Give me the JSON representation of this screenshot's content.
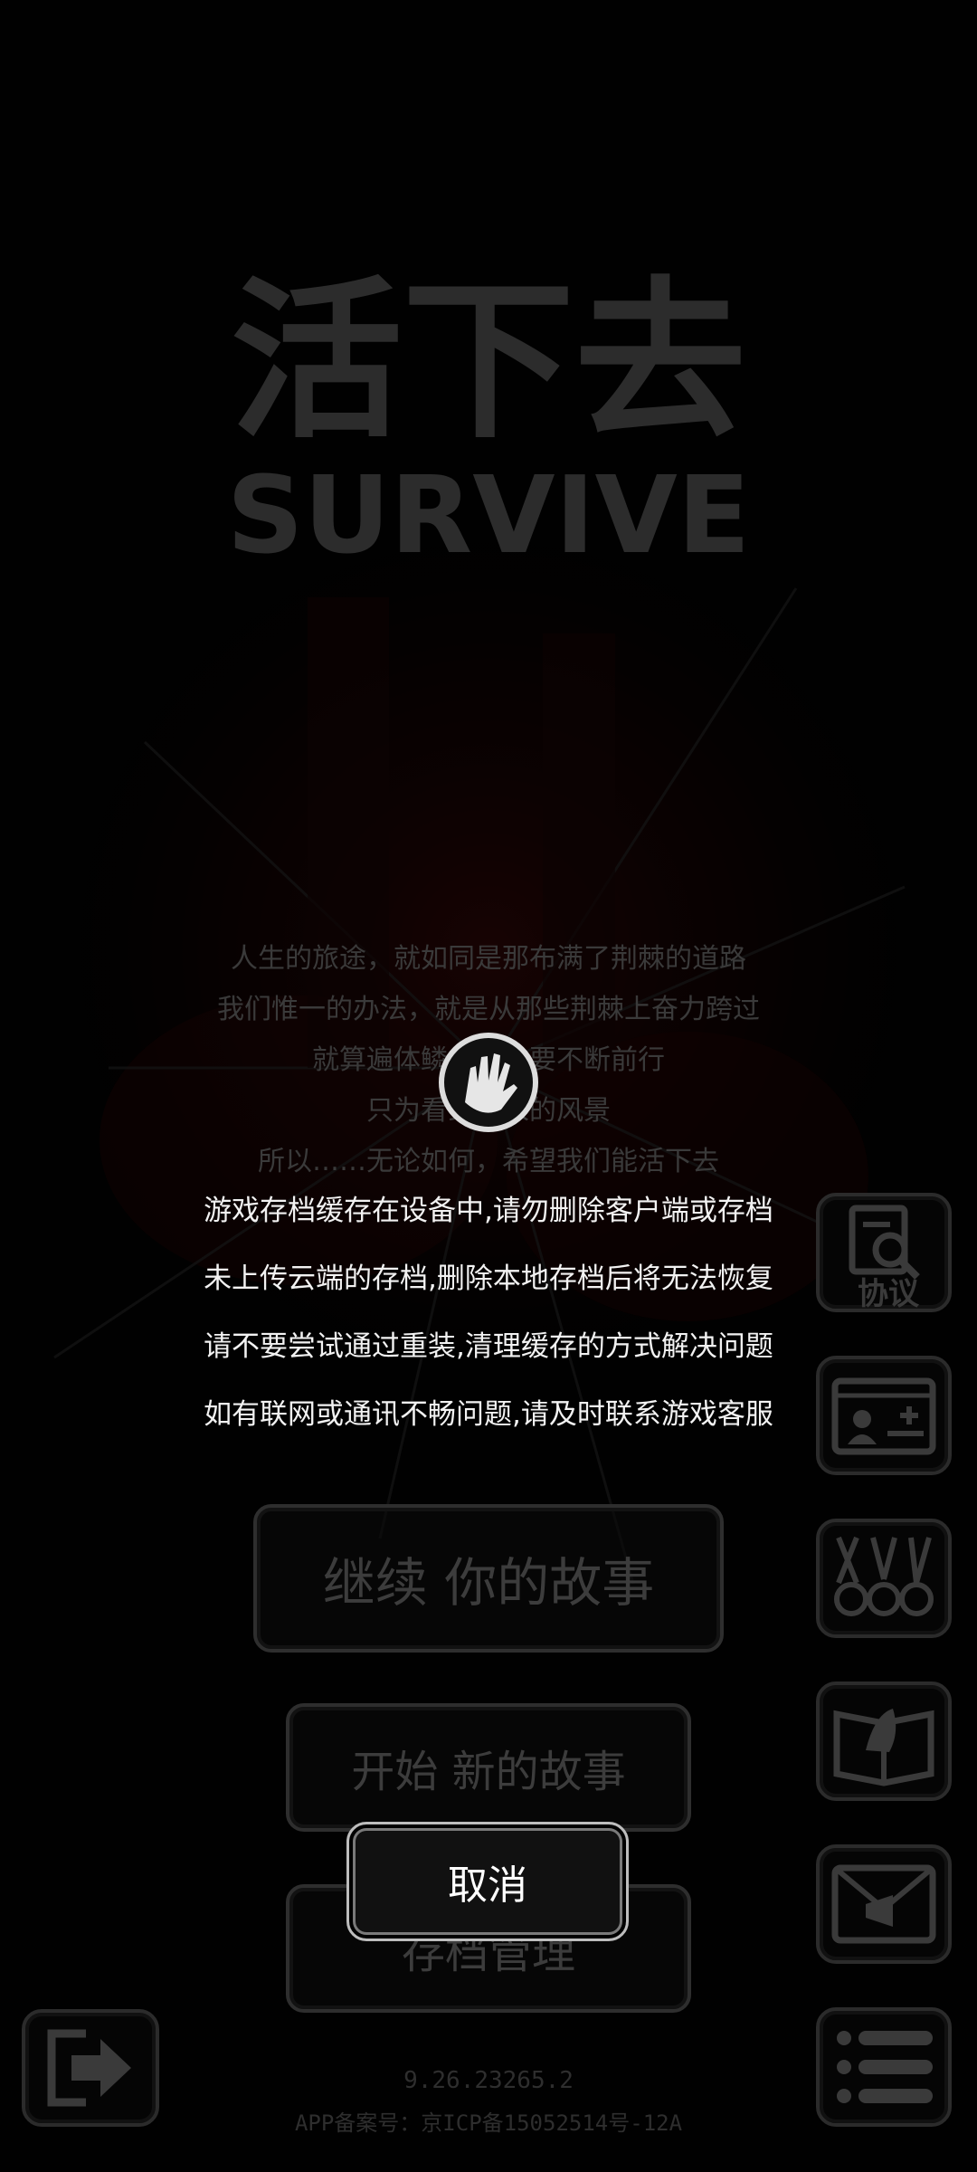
{
  "game": {
    "title_cn": "活下去",
    "title_en": "SURVIVE"
  },
  "poem": [
    "人生的旅途，就如同是那布满了荆棘的道路",
    "我们惟一的办法，就是从那些荆棘上奋力跨过",
    "就算遍体鳞伤，也要不断前行",
    "只为看到未来的风景",
    "所以……无论如何，希望我们能活下去"
  ],
  "menu": {
    "continue_label": "继续 你的故事",
    "new_label": "开始 新的故事",
    "save_label": "存档管理"
  },
  "side": {
    "agreement_label": "协议",
    "icons": [
      "agreement-icon",
      "id-card-icon",
      "medals-icon",
      "guide-book-icon",
      "mail-icon",
      "list-icon"
    ]
  },
  "footer": {
    "version": "9.26.23265.2",
    "icp": "APP备案号：京ICP备15052514号-12A"
  },
  "notice": {
    "lines": [
      "游戏存档缓存在设备中,请勿删除客户端或存档",
      "未上传云端的存档,删除本地存档后将无法恢复",
      "请不要尝试通过重装,清理缓存的方式解决问题",
      "如有联网或通讯不畅问题,请及时联系游戏客服"
    ],
    "cancel_label": "取消"
  }
}
